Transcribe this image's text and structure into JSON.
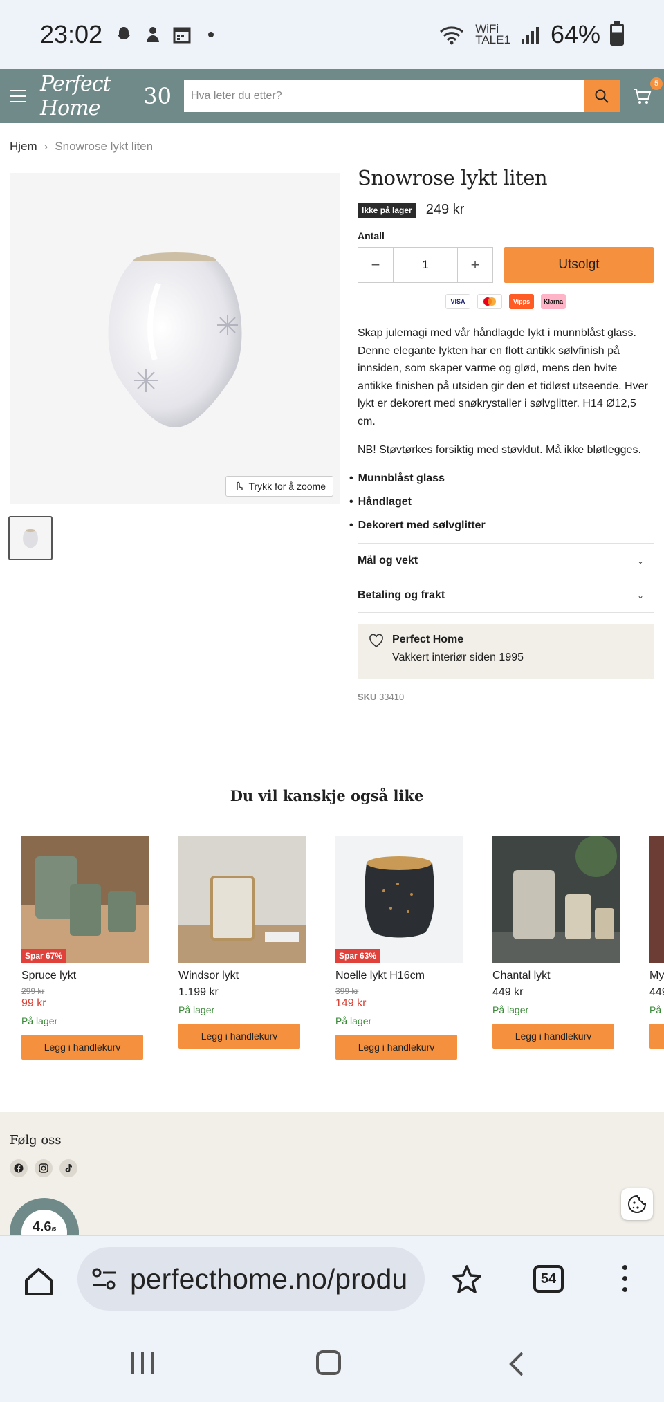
{
  "status_bar": {
    "time": "23:02",
    "wifi_label": "WiFi",
    "network_label": "TALE1",
    "battery": "64%"
  },
  "header": {
    "logo_text": "Perfect Home",
    "logo_number": "30",
    "search_placeholder": "Hva leter du etter?",
    "cart_count": "5"
  },
  "breadcrumb": {
    "home": "Hjem",
    "current": "Snowrose lykt liten"
  },
  "product": {
    "zoom_label": "Trykk for å zoome",
    "title": "Snowrose lykt liten",
    "stock_badge": "Ikke på lager",
    "price": "249 kr",
    "quantity_label": "Antall",
    "quantity_value": "1",
    "soldout_label": "Utsolgt",
    "payments": [
      "VISA",
      "Mastercard",
      "Vipps",
      "Klarna"
    ],
    "description": "Skap julemagi med vår håndlagde lykt i munnblåst glass. Denne elegante lykten har en flott antikk sølvfinish på innsiden, som skaper varme og glød, mens den hvite antikke finishen på utsiden gir den et tidløst utseende. Hver lykt er dekorert med snøkrystaller i sølvglitter. H14 Ø12,5 cm.",
    "note": "NB! Støvtørkes forsiktig med støvklut. Må ikke bløtlegges.",
    "features": [
      "Munnblåst glass",
      "Håndlaget",
      "Dekorert med sølvglitter"
    ],
    "accordion": [
      "Mål og vekt",
      "Betaling og frakt"
    ],
    "brand_name": "Perfect Home",
    "brand_tagline": "Vakkert interiør siden 1995",
    "sku_label": "SKU",
    "sku_value": "33410"
  },
  "recommendations": {
    "title": "Du vil kanskje også like",
    "items": [
      {
        "sale": "Spar 67%",
        "name": "Spruce lykt",
        "old_price": "299 kr",
        "price": "99 kr",
        "availability": "På lager",
        "button": "Legg i handlekurv"
      },
      {
        "name": "Windsor lykt",
        "price": "1.199 kr",
        "availability": "På lager",
        "button": "Legg i handlekurv"
      },
      {
        "sale": "Spar 63%",
        "name": "Noelle lykt H16cm",
        "old_price": "399 kr",
        "price": "149 kr",
        "availability": "På lager",
        "button": "Legg i handlekurv"
      },
      {
        "name": "Chantal lykt",
        "price": "449 kr",
        "availability": "På lager",
        "button": "Legg i handlekurv"
      },
      {
        "name": "Mys",
        "price": "449",
        "availability": "På l",
        "button": ""
      }
    ]
  },
  "footer": {
    "follow_label": "Følg oss",
    "rating": "4.6",
    "rating_scale": "/5"
  },
  "browser": {
    "url": "perfecthome.no/produ",
    "tab_count": "54"
  },
  "colors": {
    "header_bg": "#6f8a89",
    "accent": "#f5913e",
    "sale": "#e0413a",
    "in_stock": "#3a8a38"
  }
}
